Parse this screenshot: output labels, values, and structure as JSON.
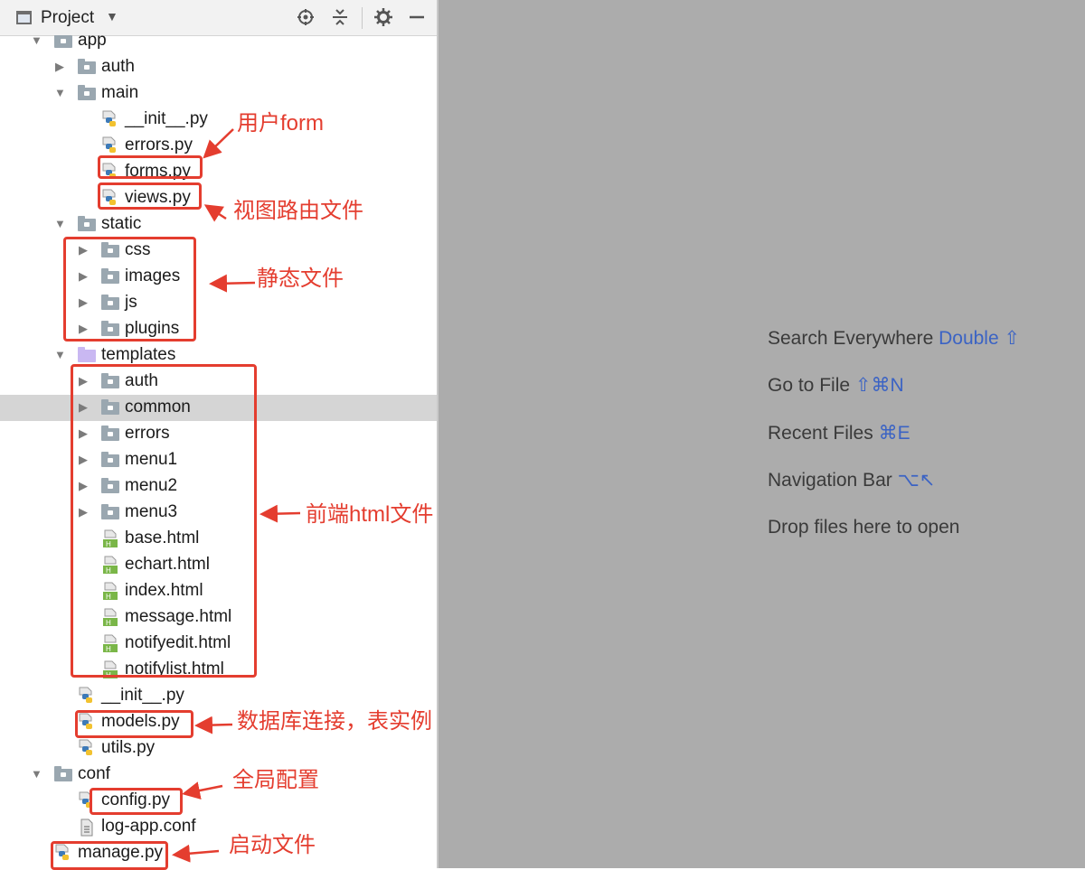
{
  "project_panel": {
    "title": "Project",
    "toolbar_icons": [
      "locate-icon",
      "collapse-all-icon",
      "gear-icon",
      "minimize-icon"
    ],
    "tree": [
      {
        "label": "app",
        "kind": "folder",
        "expanded": true
      },
      {
        "label": "auth",
        "kind": "folder",
        "expanded": false
      },
      {
        "label": "main",
        "kind": "folder",
        "expanded": true
      },
      {
        "label": "__init__.py",
        "kind": "python-file"
      },
      {
        "label": "errors.py",
        "kind": "python-file"
      },
      {
        "label": "forms.py",
        "kind": "python-file"
      },
      {
        "label": "views.py",
        "kind": "python-file"
      },
      {
        "label": "static",
        "kind": "folder",
        "expanded": true
      },
      {
        "label": "css",
        "kind": "folder",
        "expanded": false
      },
      {
        "label": "images",
        "kind": "folder",
        "expanded": false
      },
      {
        "label": "js",
        "kind": "folder",
        "expanded": false
      },
      {
        "label": "plugins",
        "kind": "folder",
        "expanded": false
      },
      {
        "label": "templates",
        "kind": "templates-folder",
        "expanded": true
      },
      {
        "label": "auth",
        "kind": "folder",
        "expanded": false
      },
      {
        "label": "common",
        "kind": "folder",
        "expanded": false,
        "selected": true
      },
      {
        "label": "errors",
        "kind": "folder",
        "expanded": false
      },
      {
        "label": "menu1",
        "kind": "folder",
        "expanded": false
      },
      {
        "label": "menu2",
        "kind": "folder",
        "expanded": false
      },
      {
        "label": "menu3",
        "kind": "folder",
        "expanded": false
      },
      {
        "label": "base.html",
        "kind": "html-file"
      },
      {
        "label": "echart.html",
        "kind": "html-file"
      },
      {
        "label": "index.html",
        "kind": "html-file"
      },
      {
        "label": "message.html",
        "kind": "html-file"
      },
      {
        "label": "notifyedit.html",
        "kind": "html-file"
      },
      {
        "label": "notifylist.html",
        "kind": "html-file"
      },
      {
        "label": "__init__.py",
        "kind": "python-file"
      },
      {
        "label": "models.py",
        "kind": "python-file"
      },
      {
        "label": "utils.py",
        "kind": "python-file"
      },
      {
        "label": "conf",
        "kind": "folder",
        "expanded": true
      },
      {
        "label": "config.py",
        "kind": "python-file"
      },
      {
        "label": "log-app.conf",
        "kind": "text-file"
      },
      {
        "label": "manage.py",
        "kind": "python-file"
      }
    ]
  },
  "editor": {
    "hints": [
      {
        "text": "Search Everywhere",
        "shortcut": "Double ⇧"
      },
      {
        "text": "Go to File",
        "shortcut": "⇧⌘N"
      },
      {
        "text": "Recent Files",
        "shortcut": "⌘E"
      },
      {
        "text": "Navigation Bar",
        "shortcut": "⌥↖"
      },
      {
        "text": "Drop files here to open",
        "shortcut": ""
      }
    ]
  },
  "annotations": [
    {
      "text": "用户form"
    },
    {
      "text": "视图路由文件"
    },
    {
      "text": "静态文件"
    },
    {
      "text": "前端html文件"
    },
    {
      "text": "数据库连接，表实例"
    },
    {
      "text": "全局配置"
    },
    {
      "text": "启动文件"
    }
  ],
  "colors": {
    "annotation_red": "#e43d2f",
    "shortcut_blue": "#3b63c4",
    "editor_background": "#acacac",
    "selection": "#d5d5d5"
  }
}
